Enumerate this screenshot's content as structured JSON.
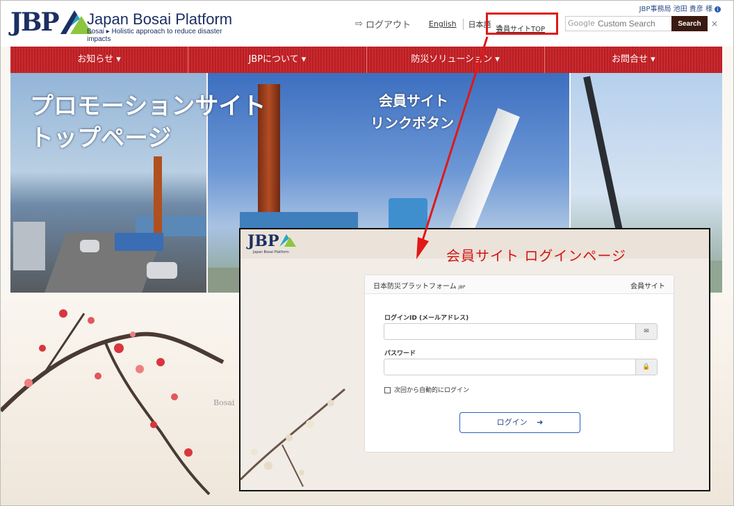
{
  "header": {
    "logo_mark": "JBP",
    "logo_name": "Japan Bosai Platform",
    "logo_subtitle": "Bosai ▸ Holistic approach to reduce disaster impacts",
    "user_line": "JBP事務局 池田 貴彦 様",
    "logout_label": "ログアウト",
    "lang_en": "English",
    "lang_ja": "日本語",
    "member_top_label": "会員サイトTOP",
    "search_placeholder": "Custom Search",
    "search_google_label": "Google",
    "search_button": "Search",
    "close_glyph": "×"
  },
  "nav": {
    "items": [
      "お知らせ ▾",
      "JBPについて ▾",
      "防災ソリューション ▾",
      "お問合せ ▾"
    ]
  },
  "hero": {
    "promo_line1": "プロモーションサイト",
    "promo_line2": "トップページ",
    "link_line1": "会員サイト",
    "link_line2": "リンクボタン"
  },
  "lower": {
    "bosai_fragment": "Bosai"
  },
  "login": {
    "logo_mark": "JBP",
    "logo_subtitle": "Japan Bosai Platform",
    "caption": "会員サイト  ログインページ",
    "card_title": "日本防災プラットフォーム",
    "card_title_small": "JBP",
    "card_right": "会員サイト",
    "id_label": "ログインID (メールアドレス)",
    "password_label": "パスワード",
    "remember_label": "次回から自動的にログイン",
    "login_button": "ログイン"
  },
  "colors": {
    "brand_navy": "#1c2f63",
    "nav_red": "#c8262b",
    "highlight_red": "#e01818",
    "search_button": "#3a1a10"
  }
}
